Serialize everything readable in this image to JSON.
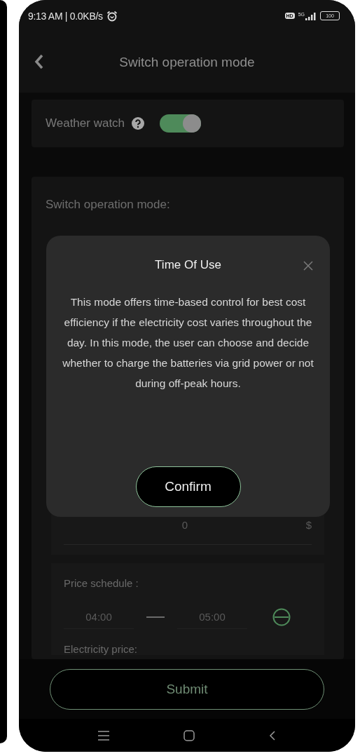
{
  "status_bar": {
    "time": "9:13 AM | 0.0KB/s",
    "hd": "HD",
    "network": "5G",
    "battery": "100"
  },
  "header": {
    "title": "Switch operation mode"
  },
  "weather_watch": {
    "label": "Weather watch",
    "on": true
  },
  "mode_card": {
    "label": "Switch operation mode:",
    "price_field": {
      "value": "0",
      "unit": "$"
    },
    "price_schedule": {
      "label": "Price schedule :",
      "start": "04:00",
      "end": "05:00"
    },
    "electricity_price_label": "Electricity price:"
  },
  "dialog": {
    "title": "Time Of Use",
    "body": "This mode offers time-based control for best cost efficiency if the electricity cost varies throughout the day. In this mode, the user can choose and decide whether to charge the batteries via grid power or not during off-peak hours.",
    "confirm": "Confirm"
  },
  "submit": "Submit"
}
